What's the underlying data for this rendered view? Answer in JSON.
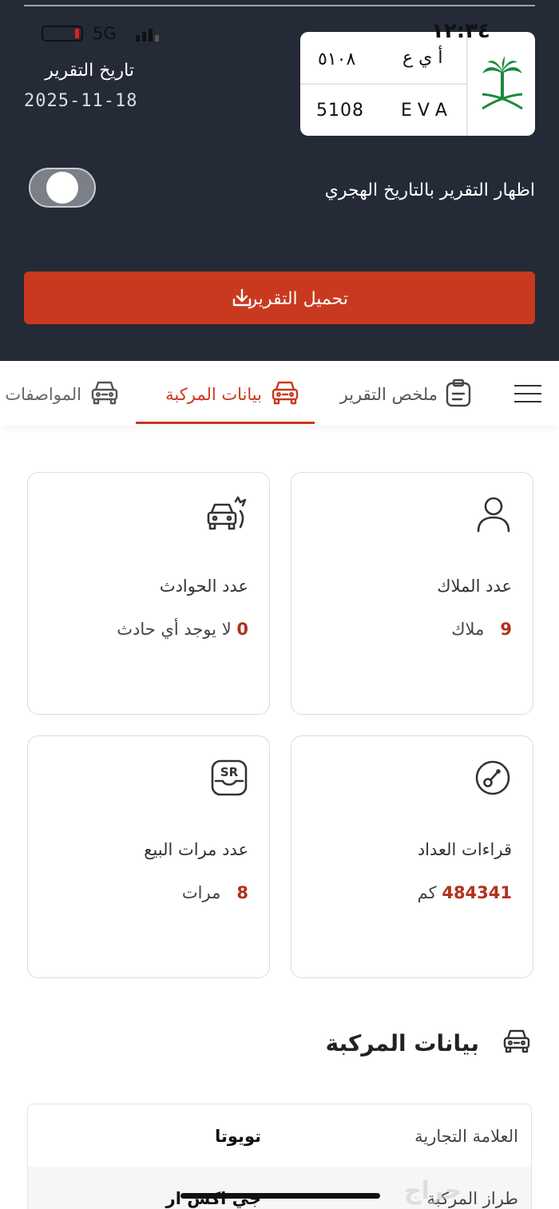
{
  "status_bar": {
    "network": "5G",
    "time": "١٢:٣٤"
  },
  "report": {
    "date_label": "تاريخ التقرير",
    "date_value": "2025-11-18",
    "hijri_toggle_label": "اظهار التقرير بالتاريخ الهجري",
    "download_label": "تحميل التقرير"
  },
  "plate": {
    "ar_letters": "أ ي ع",
    "ar_digits": "٥١٠٨",
    "en_letters": "E V A",
    "en_digits": "5108",
    "emblem_icon": "saudi-emblem-icon"
  },
  "tabs": [
    {
      "label": "ملخص التقرير",
      "icon": "clipboard-icon",
      "active": false
    },
    {
      "label": "بيانات المركبة",
      "icon": "car-icon",
      "active": true
    },
    {
      "label": "المواصفات",
      "icon": "car-icon",
      "active": false
    }
  ],
  "cards": {
    "owners": {
      "title": "عدد الملاك",
      "count": "9",
      "unit": "ملاك",
      "icon": "user-icon"
    },
    "accidents": {
      "title": "عدد الحوادث",
      "count": "0",
      "unit": "لا يوجد أي حادث",
      "icon": "car-crash-icon"
    },
    "odometer": {
      "title": "قراءات العداد",
      "count": "484341",
      "unit": "كم",
      "icon": "odometer-icon"
    },
    "sales": {
      "title": "عدد مرات البيع",
      "count": "8",
      "unit": "مرات",
      "icon": "sr-sale-icon"
    }
  },
  "vehicle_section": {
    "title": "بيانات المركبة",
    "rows": [
      {
        "key": "العلامة التجارية",
        "value": "تويوتا"
      },
      {
        "key": "طراز المركبة",
        "value": "جي اكس ار"
      }
    ]
  },
  "colors": {
    "accent": "#c9391f",
    "header_bg": "#252a37",
    "value_red": "#b3301b"
  },
  "watermark": "حراج"
}
